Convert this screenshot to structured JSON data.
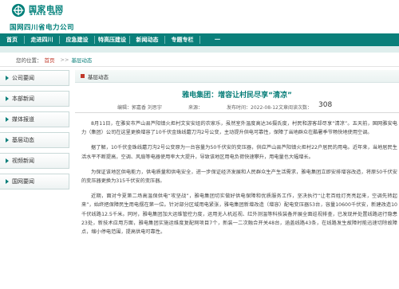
{
  "header": {
    "brand_cn": "国家电网",
    "brand_en": "STATE GRID",
    "company": "国网四川省电力公司",
    "brand_color": "#00807a"
  },
  "nav": {
    "items": [
      "首页",
      "走进四川",
      "应急建设",
      "特高压建设",
      "新闻动态",
      "专题专栏",
      "一"
    ]
  },
  "breadcrumb": {
    "prefix": "您的位置：",
    "home": "首页",
    "sep": ">>",
    "current": "基层动态"
  },
  "sidebar": {
    "items": [
      "公司要闻",
      "本部新闻",
      "媒体报道",
      "基层动态",
      "视频新闻",
      "国网要闻"
    ]
  },
  "section": {
    "title": "基层动态"
  },
  "article": {
    "title": "雅电集团：增容让村民尽享“清凉”",
    "editor": "编辑：郭嘉香 刘思宇",
    "source": "来源：",
    "date": "发布时间：2022-08-12",
    "views_label": "文章阅读次数：",
    "views": "308",
    "paragraphs": [
      "8月11日，在雅安市芦山县芦阳镇火炬村文安安组的农家乐，虽然室外温度高达36摄氏度，村民和游客却尽享“清凉”。五天前，国网雅安电力（集团）公司在这里更换增容了10千伏金珠线蘑刀沟2号公变，主动提升供电可靠性，保障了当地群众在酷暑季节畅快地使用空调。",
      "据了解，10千伏金珠线蘑刀沟2号公变原为一台容量为50千伏安的变压器，供应芦山县芦阳镇火炬村22户居民的用电。近年来，当地居民生活水平不断提高，空调、风扇等电器使用率大大提升，导致该地区用电负荷快速攀升，用电量也大幅增长。",
      "为保证该地区供电能力，供电质量和供电安全，进一步保证经济发展和人民群众生产生活需求，雅电集团立即安排增容改造，将原50千伏安的变压器更换为315千伏安的变压器。",
      "近期，面对今夏第二场高温保供电“攻坚战”，雅电集团切实做好供电保障和优质服务工作，坚决执行“让老百姓灯亮亮起来，空调先转起来”，始终把保障民生用电摆在第一位。针对部分区域用电紧张，雅电集团新增改造（增容）配电变压器53台，容量10600千伏安，新建改造10千伏线路12.5千米。同时，雅电集团加大运维管控力度，运用无人机巡视、红外测温等科技装备开展全面巡视排查，已发现并处置线路运行隐患23处，新技术应用方面，雅电集团实施运维度复配网项目7个，新装一二次融合开关48台，涵盖线路43条，在线路发生故障时能迅速切除故障点，缩小停电范围，提高供电可靠性。"
    ]
  }
}
